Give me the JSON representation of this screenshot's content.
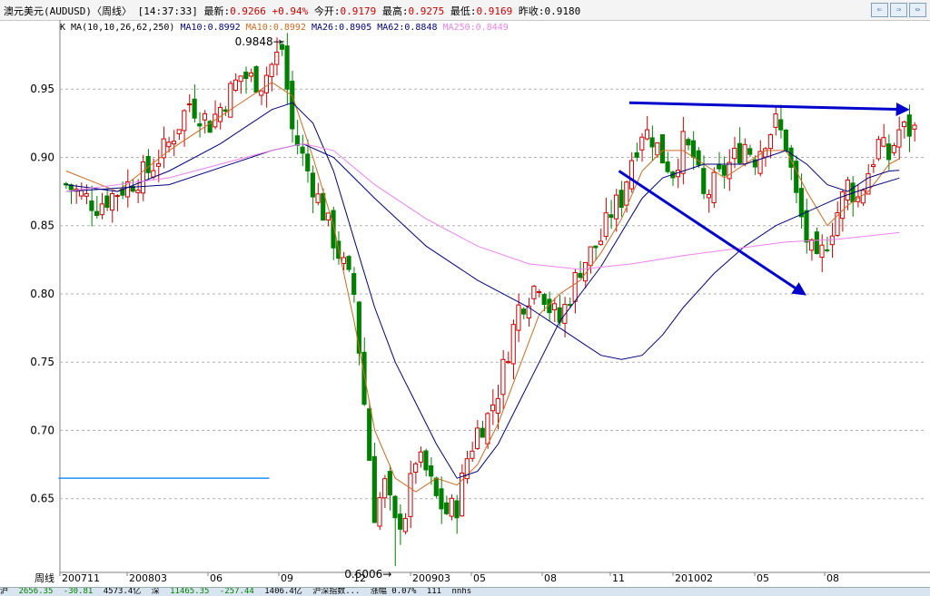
{
  "header": {
    "title": "澳元美元(AUDUSD)〈周线〉",
    "time": "[14:37:33]",
    "latest_label": "最新:",
    "latest_value": "0.9266",
    "change": "+0.94%",
    "open_label": "今开:",
    "open_value": "0.9179",
    "high_label": "最高:",
    "high_value": "0.9275",
    "low_label": "最低:",
    "low_value": "0.9169",
    "prev_label": "昨收:",
    "prev_value": "0.9180"
  },
  "ma_legend": {
    "prefix": "K   MA(10,10,26,62,250)",
    "items": [
      {
        "text": "MA10:0.8992",
        "color": "#000080"
      },
      {
        "text": "MA10:0.8992",
        "color": "#d2691e"
      },
      {
        "text": "MA26:0.8905",
        "color": "#000080"
      },
      {
        "text": "MA62:0.8848",
        "color": "#000080"
      },
      {
        "text": "MA250:0.8449",
        "color": "#ee82ee"
      }
    ]
  },
  "chart_data": {
    "type": "candlestick",
    "instrument": "AUDUSD",
    "period_label": "周线",
    "ylim": [
      0.6,
      0.99
    ],
    "y_ticks": [
      0.65,
      0.7,
      0.75,
      0.8,
      0.85,
      0.9,
      0.95
    ],
    "x_tick_labels": [
      "200711",
      "200803",
      "06",
      "09",
      "12",
      "200903",
      "05",
      "08",
      "11",
      "201002",
      "05",
      "08"
    ],
    "annotations": [
      {
        "text": "0.9848",
        "type": "high"
      },
      {
        "text": "0.6006",
        "type": "low"
      }
    ],
    "close_path": [
      [
        0,
        0.88
      ],
      [
        6,
        0.865
      ],
      [
        10,
        0.875
      ],
      [
        16,
        0.89
      ],
      [
        20,
        0.91
      ],
      [
        24,
        0.94
      ],
      [
        28,
        0.925
      ],
      [
        34,
        0.96
      ],
      [
        38,
        0.955
      ],
      [
        42,
        0.98
      ],
      [
        44,
        0.92
      ],
      [
        48,
        0.88
      ],
      [
        52,
        0.84
      ],
      [
        56,
        0.8
      ],
      [
        58,
        0.72
      ],
      [
        60,
        0.64
      ],
      [
        62,
        0.66
      ],
      [
        64,
        0.63
      ],
      [
        66,
        0.64
      ],
      [
        68,
        0.68
      ],
      [
        70,
        0.67
      ],
      [
        72,
        0.65
      ],
      [
        74,
        0.64
      ],
      [
        76,
        0.645
      ],
      [
        78,
        0.68
      ],
      [
        80,
        0.7
      ],
      [
        82,
        0.71
      ],
      [
        84,
        0.73
      ],
      [
        86,
        0.76
      ],
      [
        88,
        0.79
      ],
      [
        90,
        0.8
      ],
      [
        92,
        0.81
      ],
      [
        94,
        0.79
      ],
      [
        96,
        0.78
      ],
      [
        98,
        0.8
      ],
      [
        100,
        0.82
      ],
      [
        102,
        0.83
      ],
      [
        104,
        0.84
      ],
      [
        106,
        0.86
      ],
      [
        108,
        0.87
      ],
      [
        110,
        0.9
      ],
      [
        112,
        0.92
      ],
      [
        114,
        0.915
      ],
      [
        116,
        0.9
      ],
      [
        118,
        0.89
      ],
      [
        120,
        0.91
      ],
      [
        122,
        0.9
      ],
      [
        124,
        0.87
      ],
      [
        126,
        0.88
      ],
      [
        128,
        0.89
      ],
      [
        130,
        0.9
      ],
      [
        132,
        0.91
      ],
      [
        134,
        0.9
      ],
      [
        136,
        0.915
      ],
      [
        138,
        0.925
      ],
      [
        140,
        0.91
      ],
      [
        142,
        0.87
      ],
      [
        144,
        0.84
      ],
      [
        146,
        0.82
      ],
      [
        148,
        0.84
      ],
      [
        150,
        0.86
      ],
      [
        152,
        0.88
      ],
      [
        154,
        0.87
      ],
      [
        156,
        0.89
      ],
      [
        158,
        0.91
      ],
      [
        160,
        0.9
      ],
      [
        162,
        0.92
      ]
    ],
    "ma_series": [
      {
        "name": "MA10",
        "color": "#d2691e",
        "points": [
          [
            0,
            0.89
          ],
          [
            10,
            0.875
          ],
          [
            20,
            0.905
          ],
          [
            30,
            0.93
          ],
          [
            40,
            0.955
          ],
          [
            44,
            0.945
          ],
          [
            48,
            0.9
          ],
          [
            52,
            0.85
          ],
          [
            56,
            0.78
          ],
          [
            60,
            0.7
          ],
          [
            64,
            0.665
          ],
          [
            68,
            0.655
          ],
          [
            72,
            0.665
          ],
          [
            76,
            0.66
          ],
          [
            80,
            0.675
          ],
          [
            84,
            0.705
          ],
          [
            88,
            0.745
          ],
          [
            92,
            0.785
          ],
          [
            96,
            0.8
          ],
          [
            100,
            0.81
          ],
          [
            104,
            0.83
          ],
          [
            108,
            0.855
          ],
          [
            112,
            0.89
          ],
          [
            116,
            0.905
          ],
          [
            120,
            0.905
          ],
          [
            124,
            0.895
          ],
          [
            128,
            0.885
          ],
          [
            132,
            0.895
          ],
          [
            136,
            0.905
          ],
          [
            140,
            0.905
          ],
          [
            144,
            0.875
          ],
          [
            148,
            0.85
          ],
          [
            152,
            0.865
          ],
          [
            156,
            0.875
          ],
          [
            160,
            0.895
          ],
          [
            162,
            0.899
          ]
        ]
      },
      {
        "name": "MA26",
        "color": "#000080",
        "points": [
          [
            0,
            0.88
          ],
          [
            10,
            0.875
          ],
          [
            20,
            0.89
          ],
          [
            30,
            0.91
          ],
          [
            40,
            0.935
          ],
          [
            44,
            0.94
          ],
          [
            48,
            0.925
          ],
          [
            52,
            0.89
          ],
          [
            56,
            0.84
          ],
          [
            60,
            0.79
          ],
          [
            64,
            0.75
          ],
          [
            68,
            0.72
          ],
          [
            72,
            0.69
          ],
          [
            76,
            0.665
          ],
          [
            80,
            0.67
          ],
          [
            84,
            0.69
          ],
          [
            88,
            0.72
          ],
          [
            92,
            0.75
          ],
          [
            96,
            0.78
          ],
          [
            100,
            0.8
          ],
          [
            104,
            0.82
          ],
          [
            108,
            0.845
          ],
          [
            112,
            0.87
          ],
          [
            116,
            0.885
          ],
          [
            120,
            0.89
          ],
          [
            124,
            0.895
          ],
          [
            128,
            0.895
          ],
          [
            132,
            0.895
          ],
          [
            136,
            0.9
          ],
          [
            140,
            0.905
          ],
          [
            144,
            0.895
          ],
          [
            148,
            0.88
          ],
          [
            152,
            0.875
          ],
          [
            156,
            0.885
          ],
          [
            160,
            0.89
          ],
          [
            162,
            0.8905
          ]
        ]
      },
      {
        "name": "MA62",
        "color": "#000080",
        "points": [
          [
            0,
            0.875
          ],
          [
            20,
            0.88
          ],
          [
            40,
            0.905
          ],
          [
            46,
            0.91
          ],
          [
            52,
            0.9
          ],
          [
            60,
            0.87
          ],
          [
            70,
            0.835
          ],
          [
            80,
            0.81
          ],
          [
            90,
            0.79
          ],
          [
            96,
            0.775
          ],
          [
            100,
            0.765
          ],
          [
            104,
            0.755
          ],
          [
            108,
            0.752
          ],
          [
            112,
            0.755
          ],
          [
            116,
            0.77
          ],
          [
            120,
            0.79
          ],
          [
            126,
            0.815
          ],
          [
            132,
            0.835
          ],
          [
            138,
            0.85
          ],
          [
            144,
            0.86
          ],
          [
            150,
            0.87
          ],
          [
            156,
            0.878
          ],
          [
            162,
            0.8848
          ]
        ]
      },
      {
        "name": "MA250",
        "color": "#ee82ee",
        "points": [
          [
            0,
            0.875
          ],
          [
            20,
            0.885
          ],
          [
            40,
            0.905
          ],
          [
            46,
            0.91
          ],
          [
            52,
            0.905
          ],
          [
            60,
            0.88
          ],
          [
            70,
            0.855
          ],
          [
            80,
            0.835
          ],
          [
            90,
            0.822
          ],
          [
            100,
            0.818
          ],
          [
            110,
            0.822
          ],
          [
            120,
            0.828
          ],
          [
            130,
            0.833
          ],
          [
            140,
            0.838
          ],
          [
            150,
            0.84
          ],
          [
            162,
            0.8449
          ]
        ]
      }
    ],
    "trendlines": [
      {
        "from": [
          110,
          0.94
        ],
        "to": [
          164,
          0.935
        ],
        "color": "#0000cc",
        "arrow": true
      },
      {
        "from": [
          108,
          0.89
        ],
        "to": [
          144,
          0.8
        ],
        "color": "#0000cc",
        "arrow": true
      },
      {
        "from": [
          -1,
          0.665
        ],
        "to": [
          40,
          0.665
        ],
        "color": "#1e90ff",
        "arrow": false
      }
    ]
  },
  "footer": {
    "items": [
      "沪",
      "2656.35",
      "-30.81",
      "4573.4亿",
      "深",
      "11465.35",
      "-257.44",
      "1406.4亿",
      "沪深指数...",
      "涨幅 0.07%",
      "111",
      "nnhs"
    ]
  }
}
